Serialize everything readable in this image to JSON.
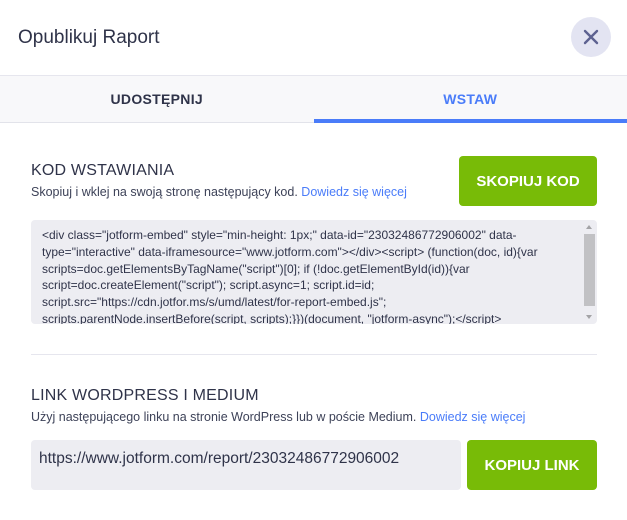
{
  "header": {
    "title": "Opublikuj Raport",
    "close_icon": "close-icon"
  },
  "tabs": [
    {
      "label": "UDOSTĘPNIJ",
      "active": false
    },
    {
      "label": "WSTAW",
      "active": true
    }
  ],
  "embed": {
    "title": "KOD WSTAWIANIA",
    "description": "Skopiuj i wklej na swoją stronę następujący kod.",
    "learn_more": "Dowiedz się więcej",
    "button": "SKOPIUJ KOD",
    "code": "<div class=\"jotform-embed\" style=\"min-height: 1px;\" data-id=\"23032486772906002\" data-type=\"interactive\" data-iframesource=\"www.jotform.com\"></div><script> (function(doc, id){var scripts=doc.getElementsByTagName(\"script\")[0]; if (!doc.getElementById(id)){var script=doc.createElement(\"script\"); script.async=1; script.id=id; script.src=\"https://cdn.jotfor.ms/s/umd/latest/for-report-embed.js\"; scripts.parentNode.insertBefore(script, scripts);}})(document, \"jotform-async\");</script>"
  },
  "wordpress": {
    "title": "LINK WORDPRESS I MEDIUM",
    "description": "Użyj następującego linku na stronie WordPress lub w poście Medium.",
    "learn_more": "Dowiedz się więcej",
    "link": "https://www.jotform.com/report/23032486772906002",
    "button": "KOPIUJ LINK"
  },
  "colors": {
    "accent": "#4a7cf9",
    "button": "#78bb07"
  }
}
